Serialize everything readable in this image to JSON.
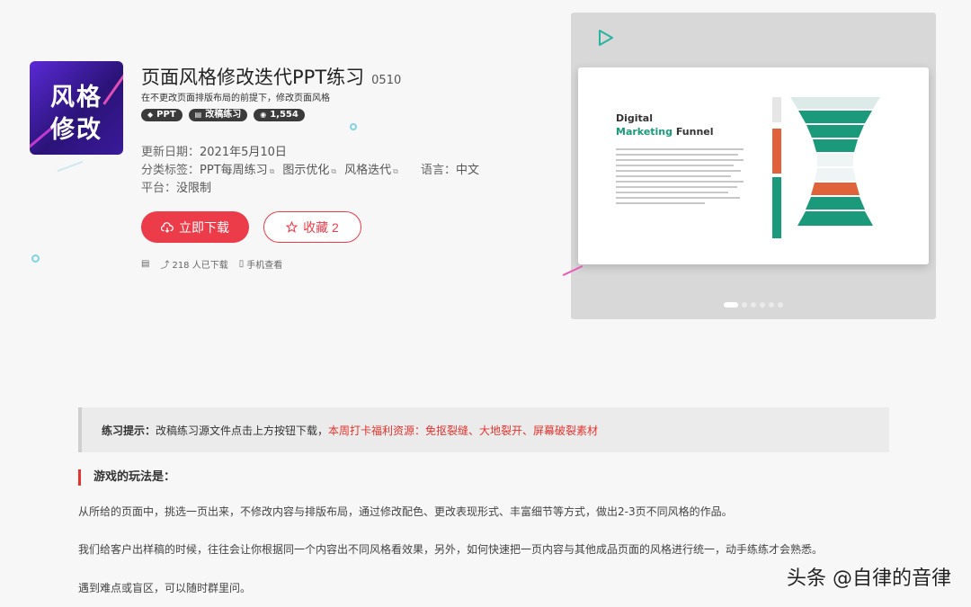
{
  "product": {
    "thumb_line1": "风格",
    "thumb_line2": "修改",
    "title": "页面风格修改迭代PPT练习",
    "code": "0510",
    "subtitle": "在不更改页面排版布局的前提下，修改页面风格",
    "badges": [
      {
        "icon": "diamond-icon",
        "label": "PPT"
      },
      {
        "icon": "doc-icon",
        "label": "改稿练习"
      },
      {
        "icon": "eye-icon",
        "label": "1,554"
      }
    ],
    "update_label": "更新日期：",
    "update_value": "2021年5月10日",
    "tags_label": "分类标签：",
    "tags": [
      "PPT每周练习",
      "图示优化",
      "风格迭代"
    ],
    "lang_label": "语言：",
    "lang_value": "中文",
    "platform_label": "平台：",
    "platform_value": "没限制"
  },
  "actions": {
    "download_label": "立即下载",
    "favorite_label": "收藏 2"
  },
  "stats": {
    "downloads": "218 人已下载",
    "mobile": "手机查看"
  },
  "preview": {
    "slide_title_line1": "Digital",
    "slide_title_green": "Marketing",
    "slide_title_rest": " Funnel",
    "active_slide": 1,
    "slide_count": 6
  },
  "tip": {
    "label": "练习提示：",
    "text": "改稿练习源文件点击上方按钮下载，",
    "red_text": "本周打卡福利资源：免抠裂缝、大地裂开、屏幕破裂素材"
  },
  "rules": {
    "title": "游戏的玩法是：",
    "paragraphs": [
      "从所给的页面中，挑选一页出来，不修改内容与排版布局，通过修改配色、更改表现形式、丰富细节等方式，做出2-3页不同风格的作品。",
      "我们给客户出样稿的时候，往往会让你根据同一个内容出不同风格看效果，另外，如何快速把一页内容与其他成品页面的风格进行统一，动手练练才会熟悉。",
      "遇到难点或盲区，可以随时群里问。"
    ]
  },
  "watermark": "头条 @自律的音律",
  "colors": {
    "accent_red": "#ec3c4a",
    "teal": "#1a9a7a",
    "orange": "#e0623a"
  }
}
